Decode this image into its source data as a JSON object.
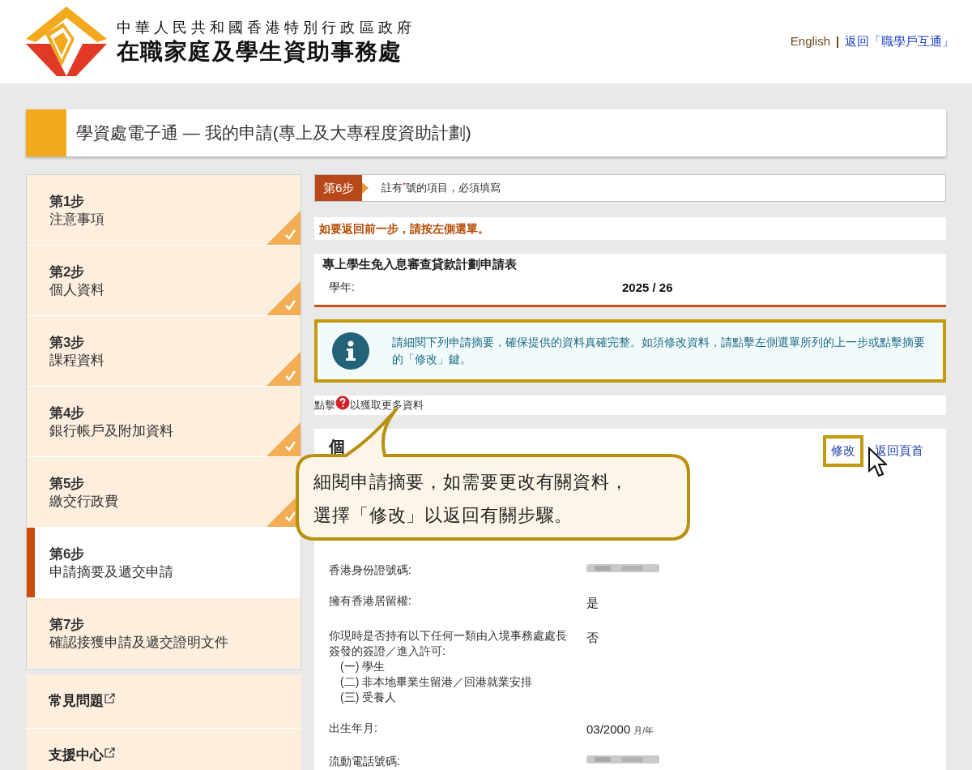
{
  "header": {
    "gov_name": "中華人民共和國香港特別行政區政府",
    "agency_name": "在職家庭及學生資助事務處",
    "links": [
      {
        "label": "English",
        "kind": "lang"
      },
      {
        "label": "返回「職學戶互通」",
        "kind": "link"
      }
    ]
  },
  "page_title": "學資處電子通 — 我的申請(專上及大專程度資助計劃)",
  "steps": [
    {
      "step": "第1步",
      "label": "注意事項",
      "completed": true,
      "selected": false
    },
    {
      "step": "第2步",
      "label": "個人資料",
      "completed": true,
      "selected": false
    },
    {
      "step": "第3步",
      "label": "課程資料",
      "completed": true,
      "selected": false
    },
    {
      "step": "第4步",
      "label": "銀行帳戶及附加資料",
      "completed": true,
      "selected": false
    },
    {
      "step": "第5步",
      "label": "繳交行政費",
      "completed": true,
      "selected": false
    },
    {
      "step": "第6步",
      "label": "申請摘要及遞交申請",
      "completed": false,
      "selected": true
    },
    {
      "step": "第7步",
      "label": "確認接獲申請及遞交證明文件",
      "completed": false,
      "selected": false
    }
  ],
  "extra_links": [
    {
      "label": "常見問題"
    },
    {
      "label": "支援中心"
    }
  ],
  "step_badge": "第6步",
  "required_note": "註有$^{*}$號的項目，必須填寫",
  "back_hint": "如要返回前一步，請按左側選單。",
  "form": {
    "title": "專上學生免入息審查貸款計劃申請表",
    "fields": [
      {
        "label": "學年:",
        "value": "2025 / 26"
      }
    ]
  },
  "info_message": "請細閱下列申請摘要，確保提供的資料真確完整。如須修改資料，請點擊左側選單所列的上一步或點擊摘要的「修改」鍵。",
  "help_hint": {
    "before": "點擊",
    "after": "以獲取更多資料"
  },
  "section": {
    "title": "個",
    "actions": [
      {
        "label": "修改",
        "highlighted": true
      },
      {
        "label": "返回頁首",
        "highlighted": false
      }
    ],
    "rows": [
      {
        "label": "香港身份證號碼:",
        "kind": "redacted"
      },
      {
        "label": "擁有香港居留權:",
        "kind": "text",
        "value": "是"
      },
      {
        "label": "你現時是否持有以下任何一類由入境事務處處長簽發的簽證／進入許可:",
        "sub": [
          "(一) 學生",
          "(二) 非本地畢業生留港／回港就業安排",
          "(三) 受養人"
        ],
        "kind": "text",
        "value": "否"
      },
      {
        "label": "出生年月:",
        "kind": "date",
        "value": "03/2000",
        "unit": "月/年"
      },
      {
        "label": "流動電話號碼:",
        "kind": "redacted"
      }
    ]
  },
  "callout": [
    "細閱申請摘要，如需要更改有關資料，",
    "選擇「修改」以返回有關步驟。"
  ]
}
